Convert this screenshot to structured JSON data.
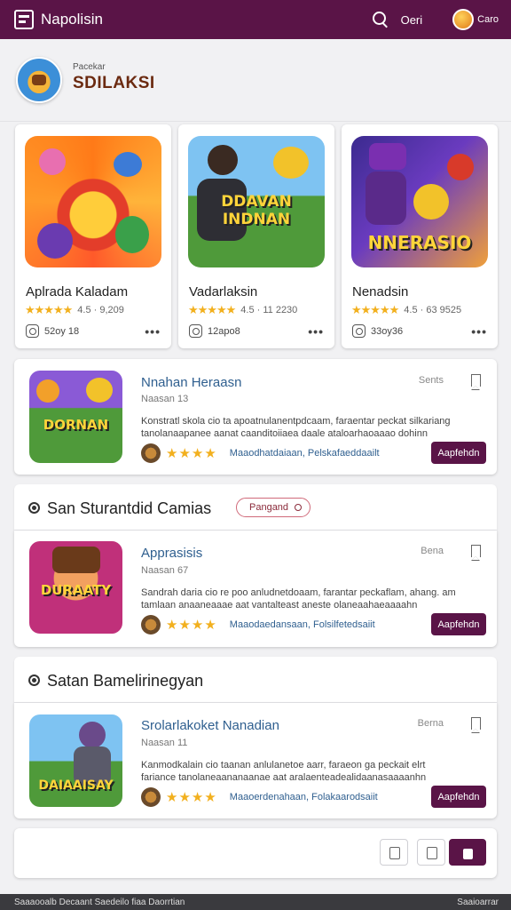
{
  "topbar": {
    "title": "Napolisin",
    "link": "Oeri",
    "user": "Caro"
  },
  "header": {
    "subtitle": "Pacekar",
    "title": "SDILAKSI"
  },
  "featured": [
    {
      "title": "Aplrada Kaladam",
      "rating": "4.5 · 9,209",
      "downloads": "52oy 18",
      "badge": ""
    },
    {
      "title": "Vadarlaksin",
      "rating": "4.5 · 11 2230",
      "downloads": "12apo8",
      "badge": "DDAVAN INDNAN"
    },
    {
      "title": "Nenadsin",
      "rating": "4.5 · 63 9525",
      "downloads": "33oy36",
      "badge": "NNERASIO"
    }
  ],
  "list_items": [
    {
      "title": "Nnahan Heraasn",
      "subtitle": "Naasan 13",
      "description": "Konstratl skola cio ta apoatnulanentpdcaam, faraentar peckat silkariang tanolanaapanee aanat caanditoiiaea daale ataloarhaoaaao dohinn",
      "tags": "Maaodhatdaiaan,   Pelskafaeddaailt",
      "save_label": "Sents",
      "cta": "Aapfehdn",
      "thumb_badge": "DORNAN"
    },
    {
      "title": "Apprasisis",
      "subtitle": "Naasan 67",
      "description": "Sandrah daria cio re poo anludnetdoaam, farantar peckaflam, ahang. am tamlaan anaaneaaae aat vantalteast aneste olaneaahaeaaaahn",
      "tags": "Maaodaedansaan,   Folsilfetedsaiit",
      "save_label": "Bena",
      "cta": "Aapfehdn",
      "thumb_badge": "DURAATY"
    },
    {
      "title": "Srolarlakoket Nanadian",
      "subtitle": "Naasan 11",
      "description": "Kanmodkalain cio taanan anlulanetoe aarr, faraeon ga peckait elrt fariance tanolaneaananaanae aat aralaenteadealidaanasaaaanhn",
      "tags": "Maaoerdenahaan,   Folakaarodsaiit",
      "save_label": "Berna",
      "cta": "Aapfehdn",
      "thumb_badge": "DAIAAISAY"
    }
  ],
  "sections": [
    {
      "title": "San Sturantdid Camias",
      "badge": "Pangand"
    },
    {
      "title": "Satan Bamelirinegyan"
    }
  ],
  "footer": {
    "left": "Saaaooalb Decaant Saedeilo fiaa Daorrtian",
    "right": "Saaioarrar"
  },
  "colors": {
    "brand": "#5a1447",
    "star": "#f2b01e",
    "link": "#2f5f8f"
  }
}
